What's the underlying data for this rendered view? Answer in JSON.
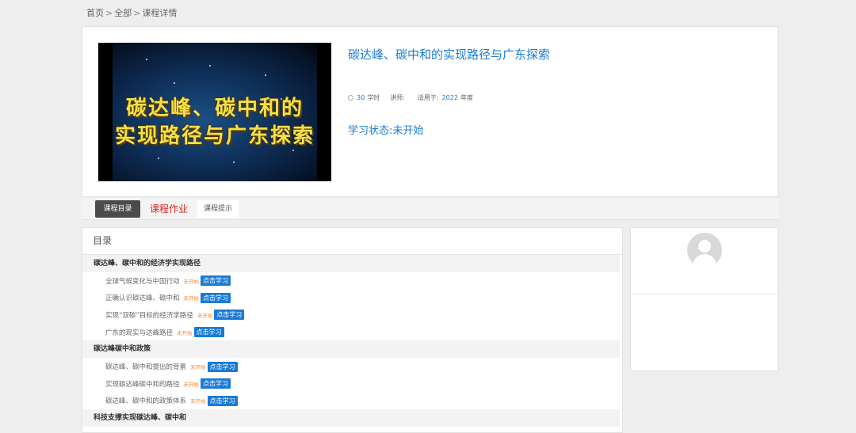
{
  "breadcrumb": {
    "home": "首页",
    "all": "全部",
    "current": "课程详情",
    "separator": ">"
  },
  "course": {
    "cover_line1": "碳达峰、碳中和的",
    "cover_line2": "实现路径与广东探索",
    "title": "碳达峰、碳中和的实现路径与广东探索",
    "hours": "30",
    "hours_unit": "学时",
    "lecturer_label": "讲师:",
    "applicable_label": "适用于:",
    "year": "2022",
    "year_unit": "年度",
    "status": "学习状态:未开始"
  },
  "tabs": {
    "catalog": "课程目录",
    "homework": "课程作业",
    "tips": "课程提示"
  },
  "catalog": {
    "title": "目录",
    "not_started": "未开始",
    "study_button": "点击学习",
    "chapter1": {
      "title": "碳达峰、碳中和的经济学实现路径",
      "lessons": [
        "全球气候变化与中国行动",
        "正确认识碳达峰、碳中和",
        "实现“双碳”目标的经济学路径",
        "广东的现实与达峰路径"
      ]
    },
    "chapter2": {
      "title": "碳达峰碳中和政策",
      "lessons": [
        "碳达峰、碳中和提出的背景",
        "实现碳达峰碳中和的路径",
        "碳达峰、碳中和的政策体系"
      ]
    },
    "chapter3": {
      "title": "科技支撑实现碳达峰、碳中和"
    }
  },
  "colors": {
    "accent": "#1a7bd5",
    "warning": "#f08a3a",
    "homework": "#e0231b"
  }
}
